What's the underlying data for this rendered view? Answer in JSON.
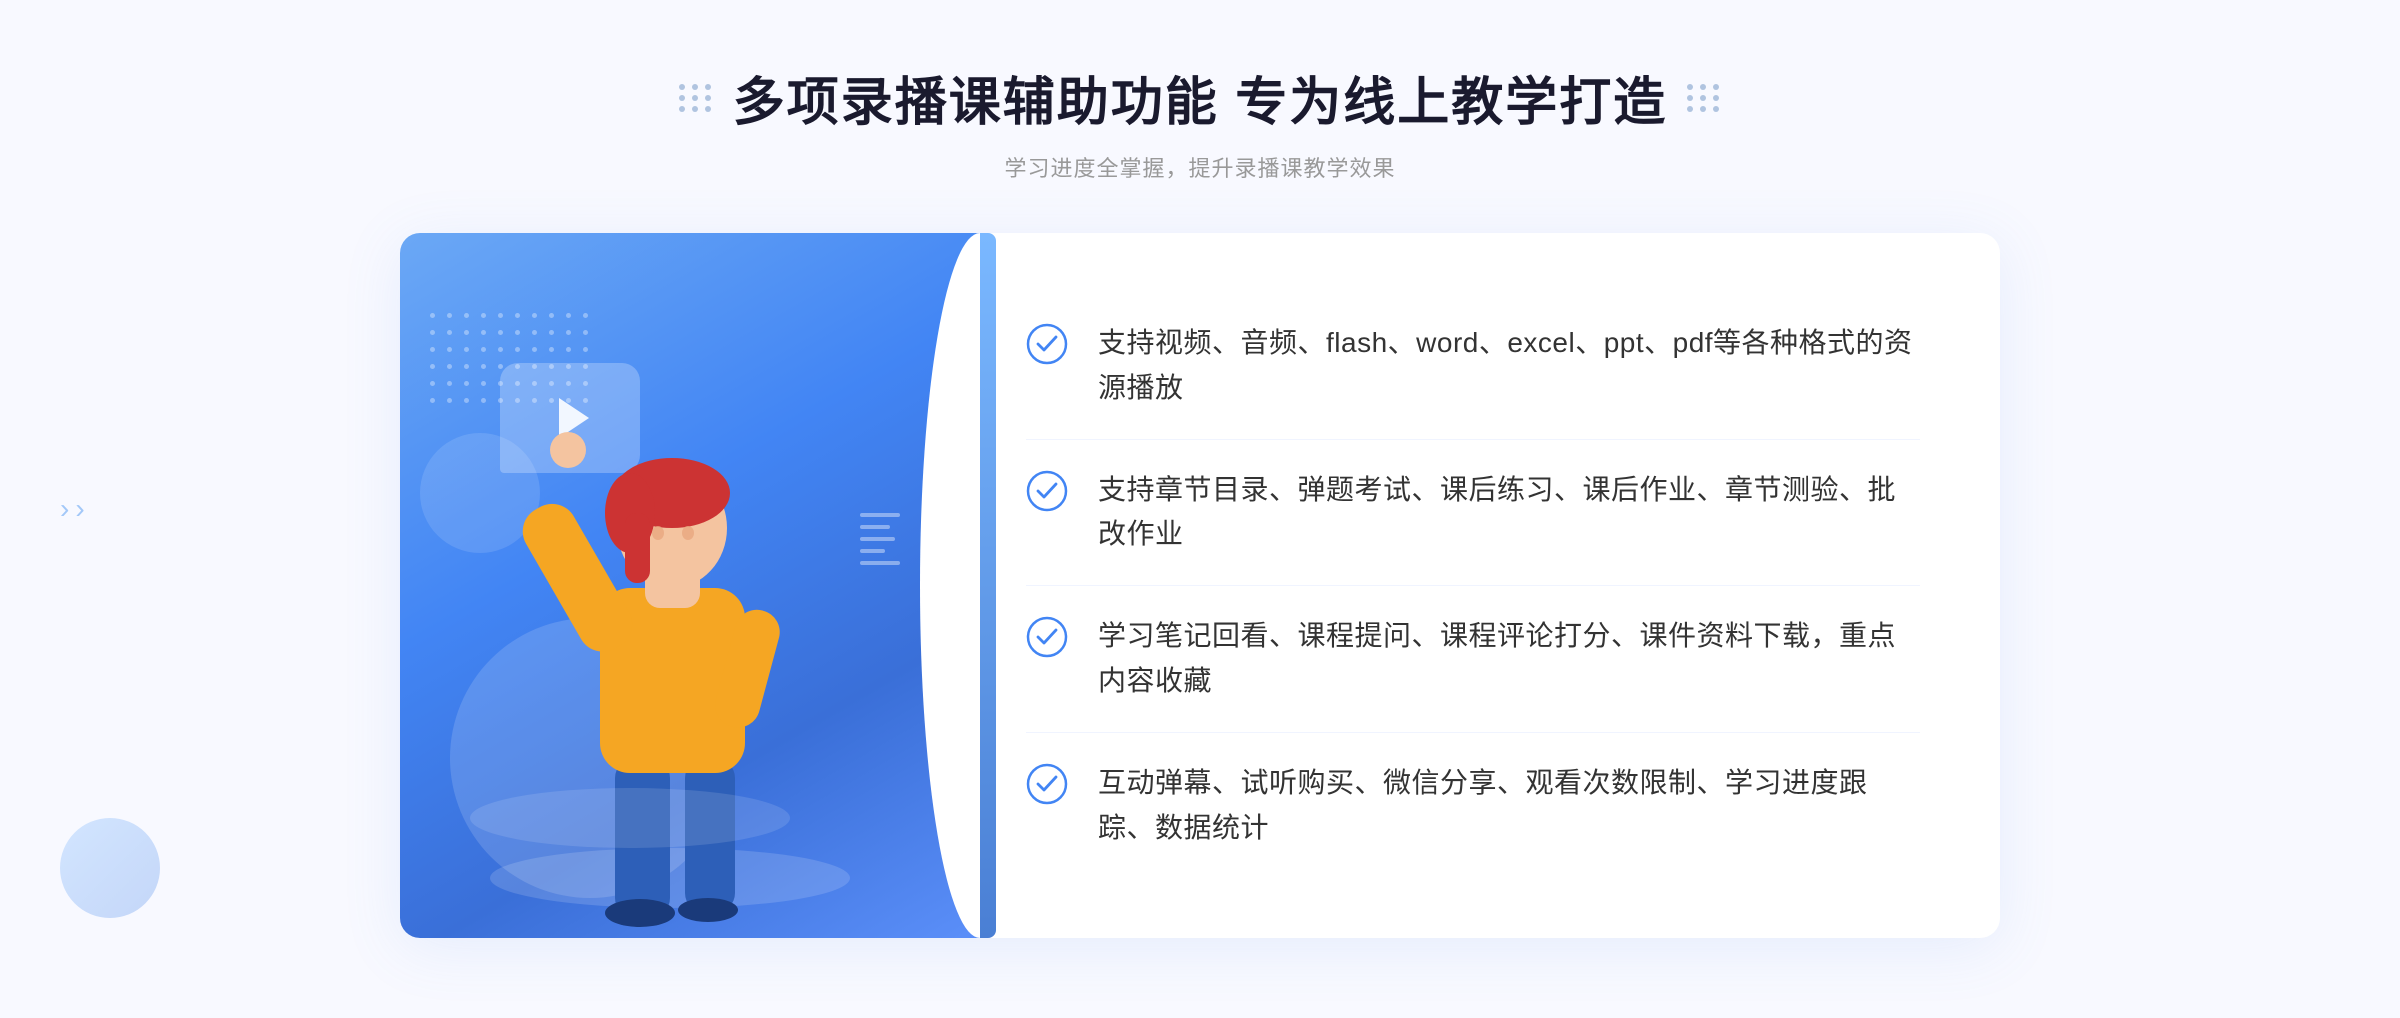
{
  "page": {
    "background_color": "#f8f9ff"
  },
  "header": {
    "title": "多项录播课辅助功能 专为线上教学打造",
    "subtitle": "学习进度全掌握，提升录播课教学效果",
    "dots_icon_left": "decorative-dots",
    "dots_icon_right": "decorative-dots"
  },
  "features": [
    {
      "id": 1,
      "text": "支持视频、音频、flash、word、excel、ppt、pdf等各种格式的资源播放",
      "icon": "check-circle-icon"
    },
    {
      "id": 2,
      "text": "支持章节目录、弹题考试、课后练习、课后作业、章节测验、批改作业",
      "icon": "check-circle-icon"
    },
    {
      "id": 3,
      "text": "学习笔记回看、课程提问、课程评论打分、课件资料下载，重点内容收藏",
      "icon": "check-circle-icon"
    },
    {
      "id": 4,
      "text": "互动弹幕、试听购买、微信分享、观看次数限制、学习进度跟踪、数据统计",
      "icon": "check-circle-icon"
    }
  ],
  "illustration": {
    "panel_gradient_start": "#6ba8f5",
    "panel_gradient_end": "#3a6fd8",
    "play_button_visible": true
  },
  "colors": {
    "primary_blue": "#4285f4",
    "light_blue": "#6ba8f5",
    "check_color": "#4285f4",
    "text_dark": "#333333",
    "text_gray": "#999999",
    "title_color": "#1a1a2e",
    "border_color": "#f0f4ff"
  }
}
